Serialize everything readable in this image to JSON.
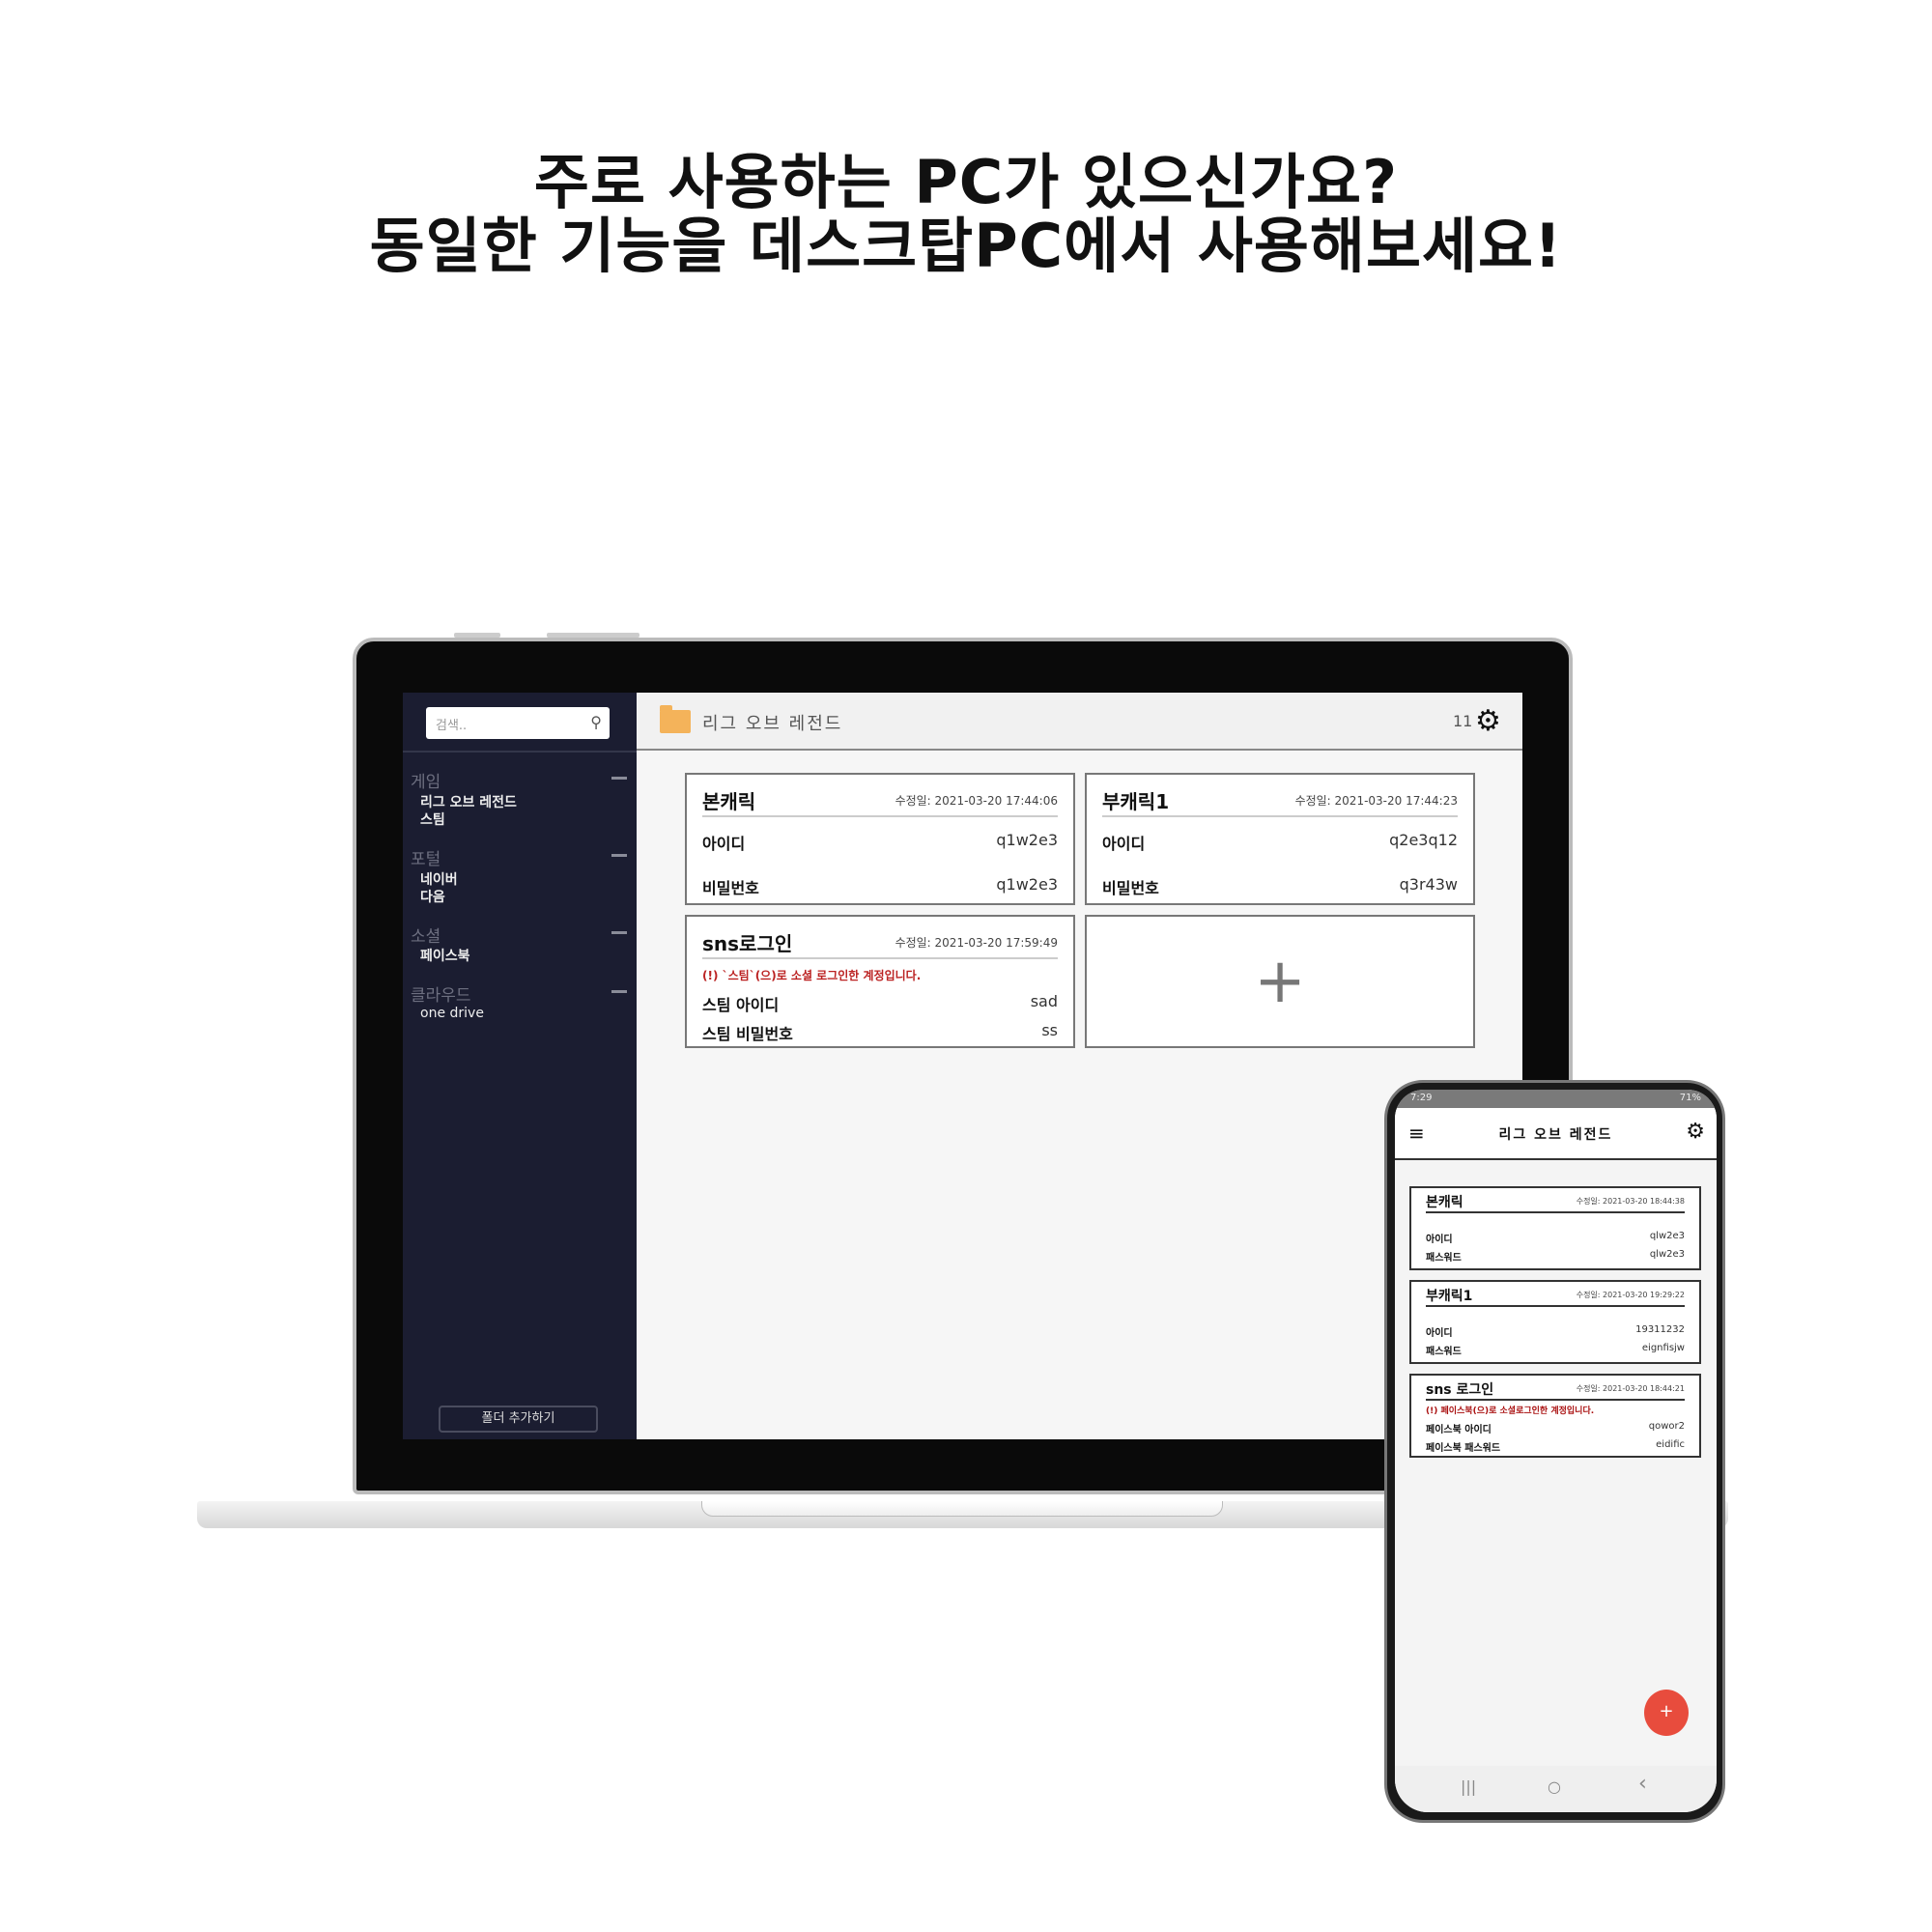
{
  "headline": {
    "line1": "주로 사용하는 PC가 있으신가요?",
    "line2": "동일한 기능을 데스크탑PC에서 사용해보세요!"
  },
  "desktop": {
    "search_placeholder": "검색..",
    "sidebar": {
      "groups": [
        {
          "label": "게임",
          "items": [
            "리그 오브 레전드",
            "스팀"
          ]
        },
        {
          "label": "포털",
          "items": [
            "네이버",
            "다음"
          ]
        },
        {
          "label": "소셜",
          "items": [
            "페이스북"
          ]
        },
        {
          "label": "클라우드",
          "items": [
            "one drive"
          ]
        }
      ],
      "add_folder": "폴더 추가하기"
    },
    "folder_title": "리그 오브 레전드",
    "count": "11",
    "cards": [
      {
        "title": "본캐릭",
        "modified": "수정일: 2021-03-20 17:44:06",
        "fields": [
          {
            "label": "아이디",
            "value": "q1w2e3"
          },
          {
            "label": "비밀번호",
            "value": "q1w2e3"
          }
        ]
      },
      {
        "title": "부캐릭1",
        "modified": "수정일: 2021-03-20 17:44:23",
        "fields": [
          {
            "label": "아이디",
            "value": "q2e3q12"
          },
          {
            "label": "비밀번호",
            "value": "q3r43w"
          }
        ]
      },
      {
        "title": "sns로그인",
        "modified": "수정일: 2021-03-20 17:59:49",
        "warning": "(!) `스팀`(으)로 소셜 로그인한 계정입니다.",
        "fields": [
          {
            "label": "스팀 아이디",
            "value": "sad"
          },
          {
            "label": "스팀 비밀번호",
            "value": "ss"
          }
        ]
      }
    ],
    "add_card": "+"
  },
  "mobile": {
    "status_left": "7:29",
    "status_right": "71%",
    "title": "리그 오브 레전드",
    "cards": [
      {
        "title": "본캐릭",
        "modified": "수정일: 2021-03-20 18:44:38",
        "fields": [
          {
            "label": "아이디",
            "value": "qlw2e3"
          },
          {
            "label": "패스워드",
            "value": "qlw2e3"
          }
        ]
      },
      {
        "title": "부캐릭1",
        "modified": "수정일: 2021-03-20 19:29:22",
        "fields": [
          {
            "label": "아이디",
            "value": "19311232"
          },
          {
            "label": "패스워드",
            "value": "eignfisjw"
          }
        ]
      },
      {
        "title": "sns 로그인",
        "modified": "수정일: 2021-03-20 18:44:21",
        "warning": "(!) 페이스북(으)로 소셜로그인한 계정입니다.",
        "fields": [
          {
            "label": "페이스북 아이디",
            "value": "qowor2"
          },
          {
            "label": "페이스북 패스워드",
            "value": "eidific"
          }
        ]
      }
    ],
    "fab": "+",
    "nav": {
      "recents": "|||",
      "home": "○",
      "back": "‹"
    }
  },
  "colors": {
    "sidebar": "#1b1d31",
    "folder": "#f4b35a",
    "fab": "#e84c3d",
    "warning": "#b22222"
  }
}
